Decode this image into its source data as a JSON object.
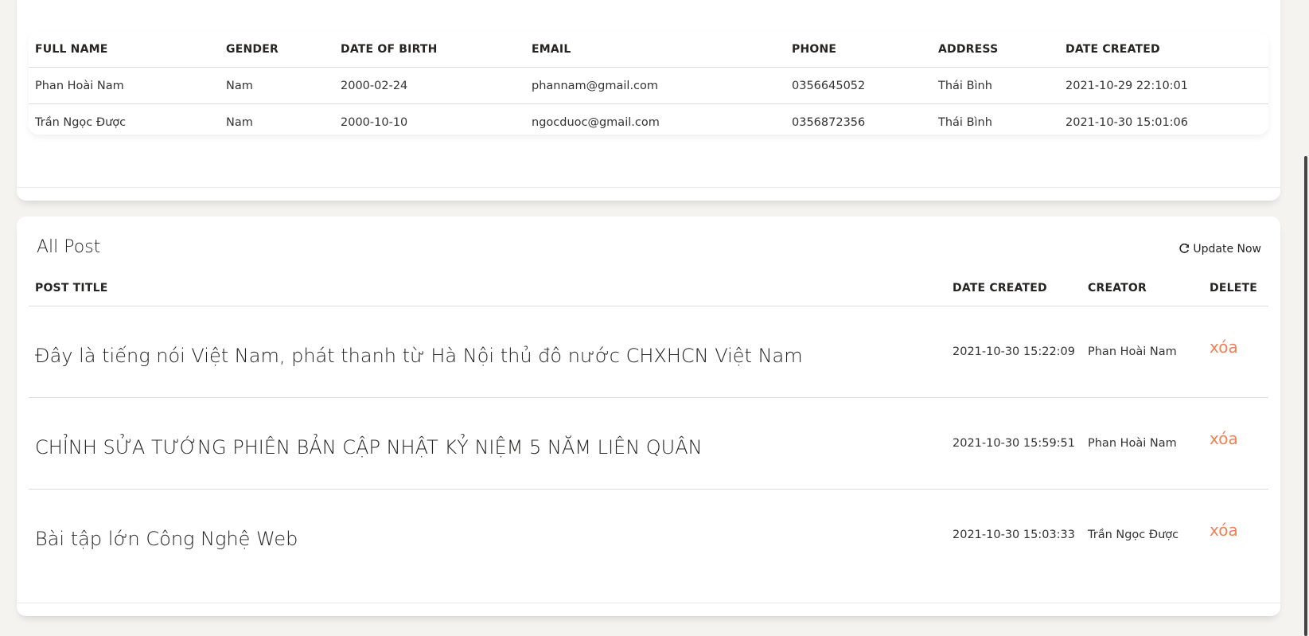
{
  "users_section": {
    "columns": [
      "FULL NAME",
      "GENDER",
      "DATE OF BIRTH",
      "EMAIL",
      "PHONE",
      "ADDRESS",
      "DATE CREATED"
    ],
    "rows": [
      [
        "Phan Hoài Nam",
        "Nam",
        "2000-02-24",
        "phannam@gmail.com",
        "0356645052",
        "Thái Bình",
        "2021-10-29 22:10:01"
      ],
      [
        "Trần Ngọc Được",
        "Nam",
        "2000-10-10",
        "ngocduoc@gmail.com",
        "0356872356",
        "Thái Bình",
        "2021-10-30 15:01:06"
      ]
    ]
  },
  "posts_section": {
    "title": "All Post",
    "update_label": "Update Now",
    "update_icon": "refresh-icon",
    "columns": [
      "POST TITLE",
      "DATE CREATED",
      "CREATOR",
      "DELETE"
    ],
    "rows": [
      {
        "title": "Đây là tiếng nói Việt Nam, phát thanh từ Hà Nội thủ đô nước CHXHCN Việt Nam",
        "date": "2021-10-30 15:22:09",
        "creator": "Phan Hoài Nam",
        "delete": "xóa"
      },
      {
        "title": "CHỈNH SỬA TƯỚNG PHIÊN BẢN CẬP NHẬT KỶ NIỆM 5 NĂM LIÊN QUÂN",
        "date": "2021-10-30 15:59:51",
        "creator": "Phan Hoài Nam",
        "delete": "xóa"
      },
      {
        "title": "Bài tập lớn Công Nghệ Web",
        "date": "2021-10-30 15:03:33",
        "creator": "Trần Ngọc Được",
        "delete": "xóa"
      }
    ]
  },
  "colors": {
    "background": "#f4f3ef",
    "card": "#ffffff",
    "delete_link": "#ef8157"
  }
}
